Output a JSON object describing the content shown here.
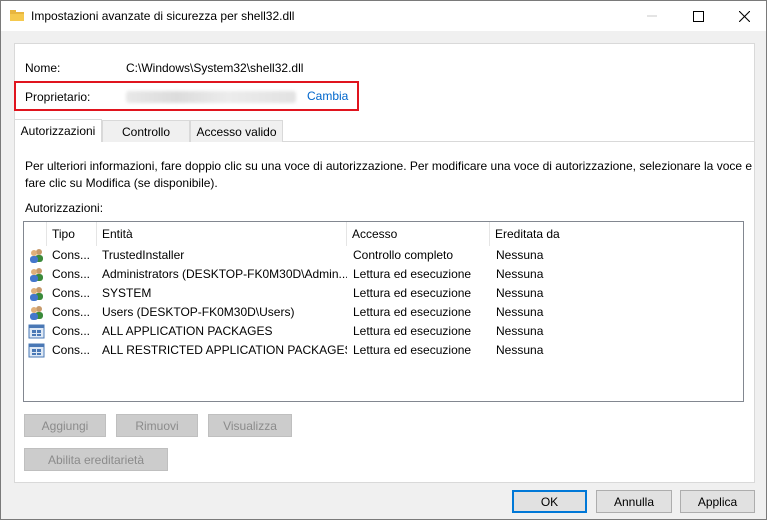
{
  "window": {
    "title": "Impostazioni avanzate di sicurezza per shell32.dll"
  },
  "fields": {
    "name_label": "Nome:",
    "name_value": "C:\\Windows\\System32\\shell32.dll",
    "owner_label": "Proprietario:",
    "owner_change": "Cambia"
  },
  "tabs": [
    {
      "label": "Autorizzazioni",
      "active": true
    },
    {
      "label": "Controllo",
      "active": false
    },
    {
      "label": "Accesso valido",
      "active": false
    }
  ],
  "info": {
    "line1": "Per ulteriori informazioni, fare doppio clic su una voce di autorizzazione. Per modificare una voce di autorizzazione, selezionare la voce e",
    "line2": "fare clic su Modifica (se disponibile).",
    "perms_label": "Autorizzazioni:"
  },
  "table": {
    "headers": [
      "Tipo",
      "Entità",
      "Accesso",
      "Ereditata da"
    ],
    "rows": [
      {
        "icon": "users-icon",
        "tipo": "Cons...",
        "entita": "TrustedInstaller",
        "accesso": "Controllo completo",
        "ereditata": "Nessuna"
      },
      {
        "icon": "users-icon",
        "tipo": "Cons...",
        "entita": "Administrators (DESKTOP-FK0M30D\\Admin...",
        "accesso": "Lettura ed esecuzione",
        "ereditata": "Nessuna"
      },
      {
        "icon": "users-icon",
        "tipo": "Cons...",
        "entita": "SYSTEM",
        "accesso": "Lettura ed esecuzione",
        "ereditata": "Nessuna"
      },
      {
        "icon": "users-icon",
        "tipo": "Cons...",
        "entita": "Users (DESKTOP-FK0M30D\\Users)",
        "accesso": "Lettura ed esecuzione",
        "ereditata": "Nessuna"
      },
      {
        "icon": "app-package-icon",
        "tipo": "Cons...",
        "entita": "ALL APPLICATION PACKAGES",
        "accesso": "Lettura ed esecuzione",
        "ereditata": "Nessuna"
      },
      {
        "icon": "app-package-icon",
        "tipo": "Cons...",
        "entita": "ALL RESTRICTED APPLICATION PACKAGES",
        "accesso": "Lettura ed esecuzione",
        "ereditata": "Nessuna"
      }
    ]
  },
  "buttons": {
    "add": "Aggiungi",
    "remove": "Rimuovi",
    "view": "Visualizza",
    "enable_inheritance": "Abilita ereditarietà",
    "ok": "OK",
    "cancel": "Annulla",
    "apply": "Applica"
  },
  "colors": {
    "highlight_border": "#e0141e",
    "link": "#0066cc",
    "default_button_border": "#0078d7"
  }
}
